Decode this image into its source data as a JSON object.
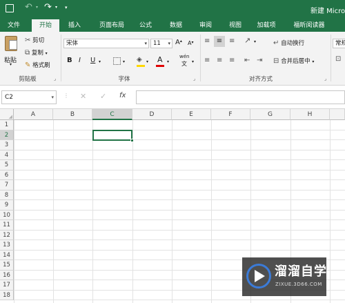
{
  "titlebar": {
    "save_icon": "save-icon",
    "undo_icon": "undo-icon",
    "redo_icon": "redo-icon",
    "title": "新建 Micro"
  },
  "tabs": [
    {
      "label": "文件",
      "active": false
    },
    {
      "label": "开始",
      "active": true
    },
    {
      "label": "插入",
      "active": false
    },
    {
      "label": "页面布局",
      "active": false
    },
    {
      "label": "公式",
      "active": false
    },
    {
      "label": "数据",
      "active": false
    },
    {
      "label": "审阅",
      "active": false
    },
    {
      "label": "视图",
      "active": false
    },
    {
      "label": "加载项",
      "active": false
    },
    {
      "label": "福昕阅读器",
      "active": false
    }
  ],
  "ribbon": {
    "clipboard": {
      "paste": "粘贴",
      "cut": "剪切",
      "copy": "复制",
      "format_painter": "格式刷",
      "group_label": "剪贴板"
    },
    "font": {
      "font_name": "宋体",
      "font_size": "11",
      "bold": "B",
      "italic": "I",
      "underline": "U",
      "grow": "A",
      "shrink": "A",
      "font_color_letter": "A",
      "phonetic": "wén",
      "group_label": "字体"
    },
    "alignment": {
      "wrap_text": "自动换行",
      "merge_center": "合并后居中",
      "group_label": "对齐方式"
    },
    "number": {
      "format": "常规"
    }
  },
  "formula_bar": {
    "name_box": "C2",
    "cancel": "✕",
    "enter": "✓",
    "fx": "fx",
    "content": ""
  },
  "sheet": {
    "columns": [
      "A",
      "B",
      "C",
      "D",
      "E",
      "F",
      "G",
      "H"
    ],
    "rows": [
      "1",
      "2",
      "3",
      "4",
      "5",
      "6",
      "7",
      "8",
      "9",
      "10",
      "11",
      "12",
      "13",
      "14",
      "15",
      "16",
      "17",
      "18"
    ],
    "selected_cell": "C2"
  },
  "watermark": {
    "name": "溜溜自学",
    "url": "ZIXUE.3D66.COM"
  },
  "colors": {
    "accent": "#217346",
    "ribbon_bg": "#f3f3f3",
    "grid": "#e2e2e2"
  }
}
